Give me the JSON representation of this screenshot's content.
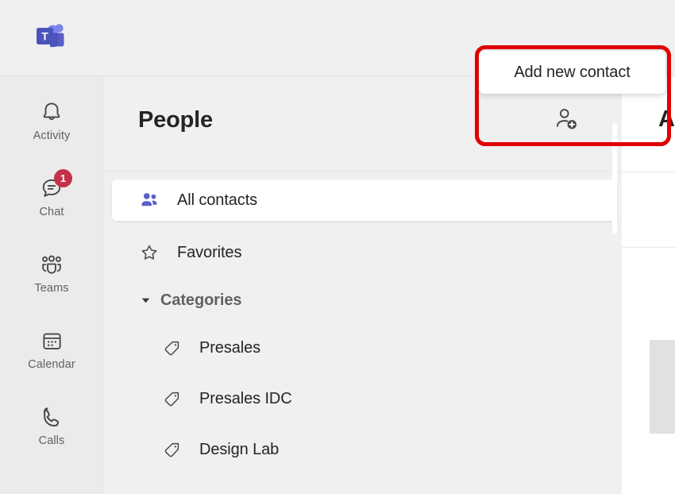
{
  "app": {
    "name": "Microsoft Teams",
    "logo_icon": "teams-logo-icon",
    "brand_color": "#5B5FC7"
  },
  "app_rail": {
    "items": [
      {
        "label": "Activity",
        "icon": "bell-icon",
        "badge": null,
        "selected": false
      },
      {
        "label": "Chat",
        "icon": "chat-bubble-icon",
        "badge": "1",
        "selected": false
      },
      {
        "label": "Teams",
        "icon": "people-group-icon",
        "badge": null,
        "selected": false
      },
      {
        "label": "Calendar",
        "icon": "calendar-icon",
        "badge": null,
        "selected": false
      },
      {
        "label": "Calls",
        "icon": "phone-icon",
        "badge": null,
        "selected": false
      }
    ],
    "badge_color": "#c4314b"
  },
  "people_pane": {
    "title": "People",
    "add_contact": {
      "icon": "person-add-icon",
      "tooltip": "Add new contact"
    },
    "rows": [
      {
        "label": "All contacts",
        "icon": "people-filled-icon",
        "selected": true,
        "indent": 0
      },
      {
        "label": "Favorites",
        "icon": "star-outline-icon",
        "selected": false,
        "indent": 0
      }
    ],
    "group": {
      "label": "Categories",
      "caret_icon": "chevron-down-icon",
      "expanded": true,
      "items": [
        {
          "label": "Presales",
          "icon": "tag-icon",
          "selected": false,
          "indent": 1
        },
        {
          "label": "Presales IDC",
          "icon": "tag-icon",
          "selected": false,
          "indent": 1
        },
        {
          "label": "Design Lab",
          "icon": "tag-icon",
          "selected": false,
          "indent": 1
        }
      ]
    }
  },
  "content_pane": {
    "title": "All contacts"
  },
  "annotation": {
    "shape": "rounded-rectangle",
    "color": "#e00000"
  }
}
